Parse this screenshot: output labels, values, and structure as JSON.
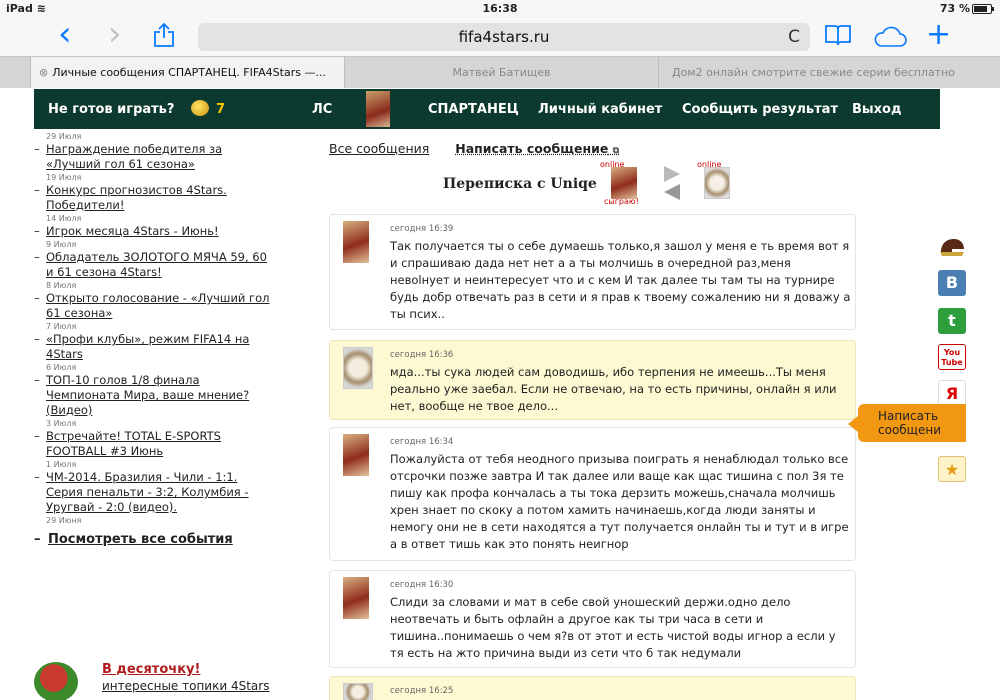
{
  "status": {
    "device": "iPad",
    "time": "16:38",
    "battery": "73 %"
  },
  "browser": {
    "url": "fifa4stars.ru",
    "back_icon": "‹",
    "forward_icon": "›",
    "share_icon": "share-icon",
    "reload_icon": "C",
    "tabs": [
      {
        "label": "Личные сообщения СПАРТАНЕЦ. FIFA4Stars —...",
        "close": "⊗"
      },
      {
        "label": "Матвей Батищев"
      },
      {
        "label": "Дом2 онлайн смотрите свежие серии бесплатно"
      }
    ]
  },
  "nav": {
    "not_ready": "Не готов играть?",
    "coins": "7",
    "ls": "ЛС",
    "user": "СПАРТАНЕЦ",
    "cabinet": "Личный кабинет",
    "report": "Сообщить результат",
    "exit": "Выход"
  },
  "sidebar": {
    "first_date": "29 Июля",
    "items": [
      {
        "title": "Награждение победителя за «Лучший гол 61 сезона»",
        "date": "19 Июля"
      },
      {
        "title": "Конкурс прогнозистов 4Stars. Победители!",
        "date": "14 Июля"
      },
      {
        "title": "Игрок месяца 4Stars - Июнь!",
        "date": "9 Июля"
      },
      {
        "title": "Обладатель ЗОЛОТОГО МЯЧА 59, 60 и 61 сезона 4Stars!",
        "date": "8 Июля"
      },
      {
        "title": "Открыто голосование - «Лучший гол 61 сезона»",
        "date": "7 Июля"
      },
      {
        "title": "«Профи клубы», режим FIFA14 на 4Stars",
        "date": "6 Июля"
      },
      {
        "title": "ТОП-10 голов 1/8 финала Чемпионата Мира, ваше мнение? (Видео)",
        "date": "3 Июля"
      },
      {
        "title": "Встречайте! TOTAL E-SPORTS FOOTBALL #3 Июнь",
        "date": "1 Июля"
      },
      {
        "title": "ЧМ-2014. Бразилия - Чили - 1:1. Серия пенальти - 3:2, Колумбия - Уругвай - 2:0 (видео).",
        "date": "29 Июня"
      }
    ],
    "all_events": "Посмотреть все события",
    "promo_title": "В десяточку!",
    "promo_sub": "интересные топики 4Stars"
  },
  "main": {
    "all_messages": "Все сообщения",
    "write_message": "Написать сообщение",
    "ext_icon": "⧉",
    "conversation_title": "Переписка с Uniqe",
    "online_label": "online",
    "online_label_2": "online",
    "play_label": "сыграю!",
    "messages": [
      {
        "author": "me",
        "time": "сегодня 16:39",
        "text": "Так получается ты о себе думаешь только,я зашол у меня е ть время вот я и спрашиваю дада нет нет а а ты молчишь в очередной раз,меня невolнует и неинтересует что и с кем И так далее ты там ты на турнире будь добр отвечать раз в сети и я прав к твоему сожалению ни я доважу а ты псих.."
      },
      {
        "author": "them",
        "time": "сегодня 16:36",
        "text": "мда...ты сука людей сам доводишь, ибо терпения не имеешь...Ты меня реально уже заебал. Если не отвечаю, на то есть причины, онлайн я или нет, вообще не твое дело..."
      },
      {
        "author": "me",
        "time": "сегодня 16:34",
        "text": "Пожалуйста от тебя неодного призыва поиграть я ненаблюдал только все отсрочки позже завтра И так далее или ваще как щас тишина с пол 3я те пишу как профа кончалась а ты тока дерзить можешь,сначала молчишь хрен знает по скоку а потом хамить начинаешь,когда люди заняты и немогу они не в сети находятся а тут получается онлайн ты и тут и в игре а в ответ тишь как это понять неигнор"
      },
      {
        "author": "me",
        "time": "сегодня 16:30",
        "text": "Слиди за словами и мат в себе свой уношеский держи.одно дело неотвечать и быть офлайн а другое как ты три часа в сети и тишина..понимаешь о чем я?в от этот и есть чистой воды игнор а если у тя есть на жто причина выди из сети что б так недумали"
      },
      {
        "author": "me",
        "time": "сегодня 16:25",
        "text": ""
      }
    ]
  },
  "side": {
    "write_tab": "Написать сообщени",
    "vk": "B",
    "twitter": "t",
    "youtube": "You Tube",
    "yandex": "Я",
    "star": "★"
  }
}
